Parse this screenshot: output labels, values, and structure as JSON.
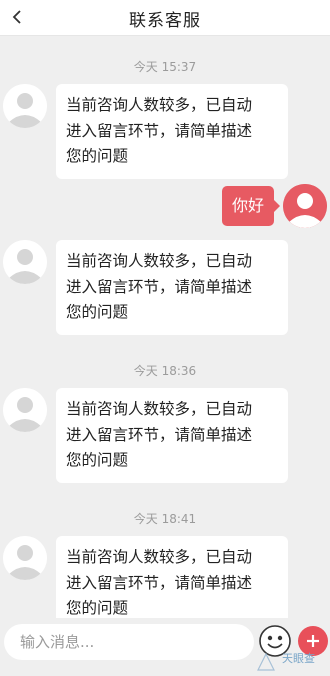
{
  "header": {
    "title": "联系客服",
    "back_icon": "chevron-left-icon"
  },
  "messages": [
    {
      "type": "timestamp",
      "text": "今天 15:37"
    },
    {
      "type": "received",
      "lines": [
        "当前咨询人数较多，已自动",
        "进入留言环节，请简单描述",
        "您的问题"
      ]
    },
    {
      "type": "sent",
      "text": "你好"
    },
    {
      "type": "received",
      "lines": [
        "当前咨询人数较多，已自动",
        "进入留言环节，请简单描述",
        "您的问题"
      ]
    },
    {
      "type": "timestamp",
      "text": "今天 18:36"
    },
    {
      "type": "received",
      "lines": [
        "当前咨询人数较多，已自动",
        "进入留言环节，请简单描述",
        "您的问题"
      ]
    },
    {
      "type": "timestamp",
      "text": "今天 18:41"
    },
    {
      "type": "received",
      "lines": [
        "当前咨询人数较多，已自动",
        "进入留言环节，请简单描述",
        "您的问题"
      ]
    }
  ],
  "composer": {
    "placeholder": "输入消息...",
    "emoji_icon": "emoji-face-icon",
    "add_icon": "plus-circle-icon"
  },
  "watermark": {
    "text": "天眼查"
  },
  "colors": {
    "accent": "#e75a62",
    "background": "#efefef",
    "bubble": "#ffffff"
  }
}
